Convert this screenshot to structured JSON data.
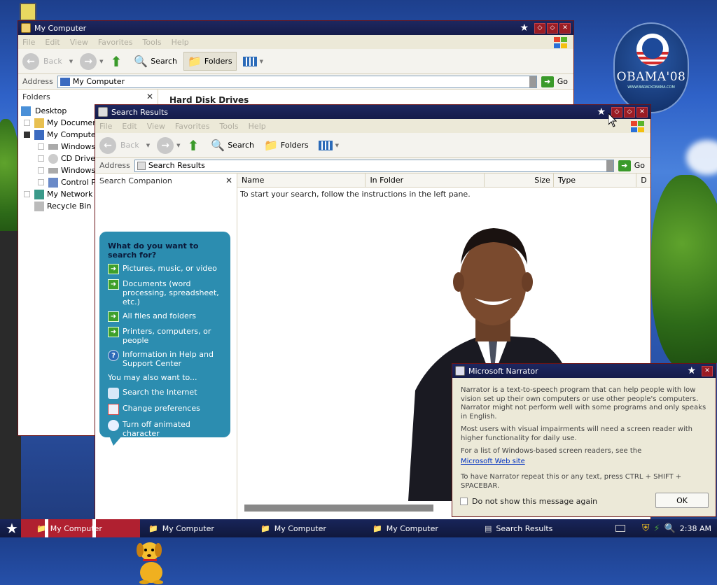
{
  "desktop": {
    "logo_text": "OBAMA'08",
    "logo_sub": "WWW.BARACKOBAMA.COM"
  },
  "my_computer_window": {
    "title": "My Computer",
    "menu": [
      "File",
      "Edit",
      "View",
      "Favorites",
      "Tools",
      "Help"
    ],
    "toolbar": {
      "back": "Back",
      "search": "Search",
      "folders": "Folders"
    },
    "address_label": "Address",
    "address_value": "My Computer",
    "go_label": "Go",
    "folders_header": "Folders",
    "right_heading": "Hard Disk Drives",
    "tree": [
      {
        "label": "Desktop",
        "indent": 0
      },
      {
        "label": "My Documents",
        "indent": 1
      },
      {
        "label": "My Computer",
        "indent": 1
      },
      {
        "label": "Windows XP (C:)",
        "indent": 2
      },
      {
        "label": "CD Drive (D:)",
        "indent": 2
      },
      {
        "label": "Windows XP (E:)",
        "indent": 2
      },
      {
        "label": "Control Panel",
        "indent": 2
      },
      {
        "label": "My Network Places",
        "indent": 1
      },
      {
        "label": "Recycle Bin",
        "indent": 1
      }
    ]
  },
  "search_window": {
    "title": "Search Results",
    "menu": [
      "File",
      "Edit",
      "View",
      "Favorites",
      "Tools",
      "Help"
    ],
    "toolbar": {
      "back": "Back",
      "search": "Search",
      "folders": "Folders"
    },
    "address_label": "Address",
    "address_value": "Search Results",
    "go_label": "Go",
    "companion_header": "Search Companion",
    "columns": [
      "Name",
      "In Folder",
      "Size",
      "Type",
      "D"
    ],
    "hint": "To start your search, follow the instructions in the left pane.",
    "question": "What do you want to search for?",
    "options": [
      "Pictures, music, or video",
      "Documents (word processing, spreadsheet, etc.)",
      "All files and folders",
      "Printers, computers, or people"
    ],
    "help_option": "Information in Help and Support Center",
    "also_label": "You may also want to...",
    "also_options": [
      "Search the Internet",
      "Change preferences",
      "Turn off animated character"
    ]
  },
  "narrator": {
    "title": "Microsoft Narrator",
    "p1": "Narrator is a text-to-speech program that can help people with low vision set up their own computers or use other people's computers. Narrator might not perform well with some programs and only speaks in English.",
    "p2": "Most users with visual impairments will need a screen reader with higher functionality for daily use.",
    "p3": "For a list of Windows-based screen readers, see the",
    "link": "Microsoft Web site",
    "p4": "To have Narrator repeat this or any text, press CTRL + SHIFT + SPACEBAR.",
    "checkbox": "Do not show this message again",
    "ok": "OK"
  },
  "taskbar": {
    "tasks": [
      "My Computer",
      "My Computer",
      "My Computer",
      "My Computer",
      "Search Results"
    ],
    "clock": "2:38 AM"
  }
}
